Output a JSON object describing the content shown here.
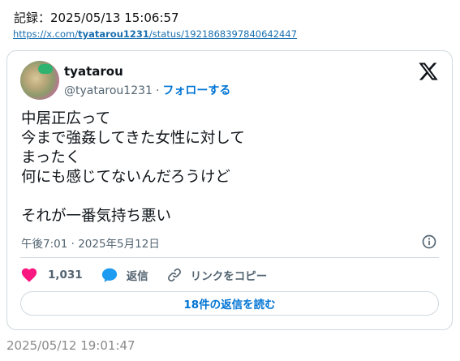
{
  "record": {
    "label": "記録：2025/05/13 15:06:57",
    "link_prefix": "https://x.com/",
    "link_user": "tyatarou1231",
    "link_suffix": "/status/1921868397840642447"
  },
  "tweet": {
    "author_name": "tyatarou",
    "handle": "@tyatarou1231",
    "separator": "·",
    "follow_label": "フォローする",
    "text": "中居正広って\n今まで強姦してきた女性に対して\nまったく\n何にも感じてないんだろうけど\n\nそれが一番気持ち悪い",
    "timestamp": "午後7:01 · 2025年5月12日",
    "likes": "1,031",
    "reply_label": "返信",
    "copy_link_label": "リンクをコピー",
    "read_replies_label": "18件の返信を読む"
  },
  "footer": {
    "date": "2025/05/12 19:01:47"
  },
  "colors": {
    "like": "#f91880",
    "reply": "#1d9bf0",
    "link_blue": "#0074d4"
  },
  "icons": [
    "x-logo-icon",
    "info-icon",
    "heart-icon",
    "reply-bubble-icon",
    "link-icon"
  ]
}
